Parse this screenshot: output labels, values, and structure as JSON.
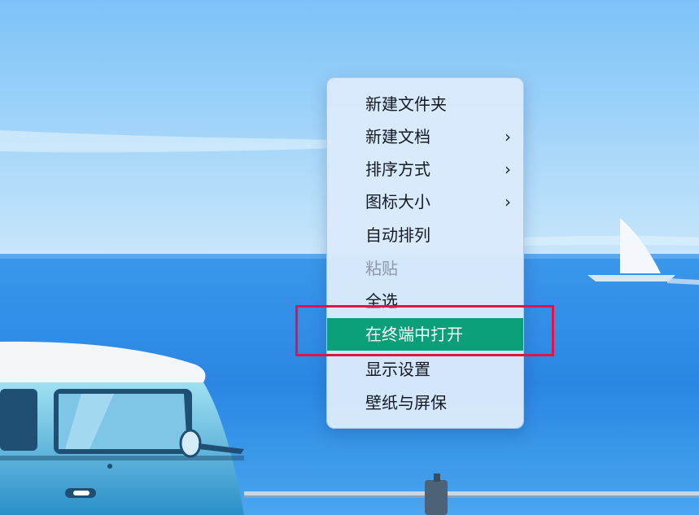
{
  "desktop": {
    "colors": {
      "sky_top": "#7ec4f8",
      "sky_bottom": "#c6e4f8",
      "sea": "#2f8fe6",
      "sea_deep": "#1a6fd6",
      "highlight_frame": "#e2134a",
      "menu_selected": "#0a9e79"
    }
  },
  "context_menu": {
    "items": [
      {
        "label": "新建文件夹",
        "submenu": false,
        "enabled": true
      },
      {
        "label": "新建文档",
        "submenu": true,
        "enabled": true
      },
      {
        "label": "排序方式",
        "submenu": true,
        "enabled": true
      },
      {
        "label": "图标大小",
        "submenu": true,
        "enabled": true
      },
      {
        "label": "自动排列",
        "submenu": false,
        "enabled": true
      },
      {
        "label": "粘贴",
        "submenu": false,
        "enabled": false
      },
      {
        "label": "全选",
        "submenu": false,
        "enabled": true
      },
      {
        "label": "在终端中打开",
        "submenu": false,
        "enabled": true,
        "selected": true
      },
      {
        "label": "显示设置",
        "submenu": false,
        "enabled": true
      },
      {
        "label": "壁纸与屏保",
        "submenu": false,
        "enabled": true
      }
    ],
    "submenu_glyph": "›"
  }
}
